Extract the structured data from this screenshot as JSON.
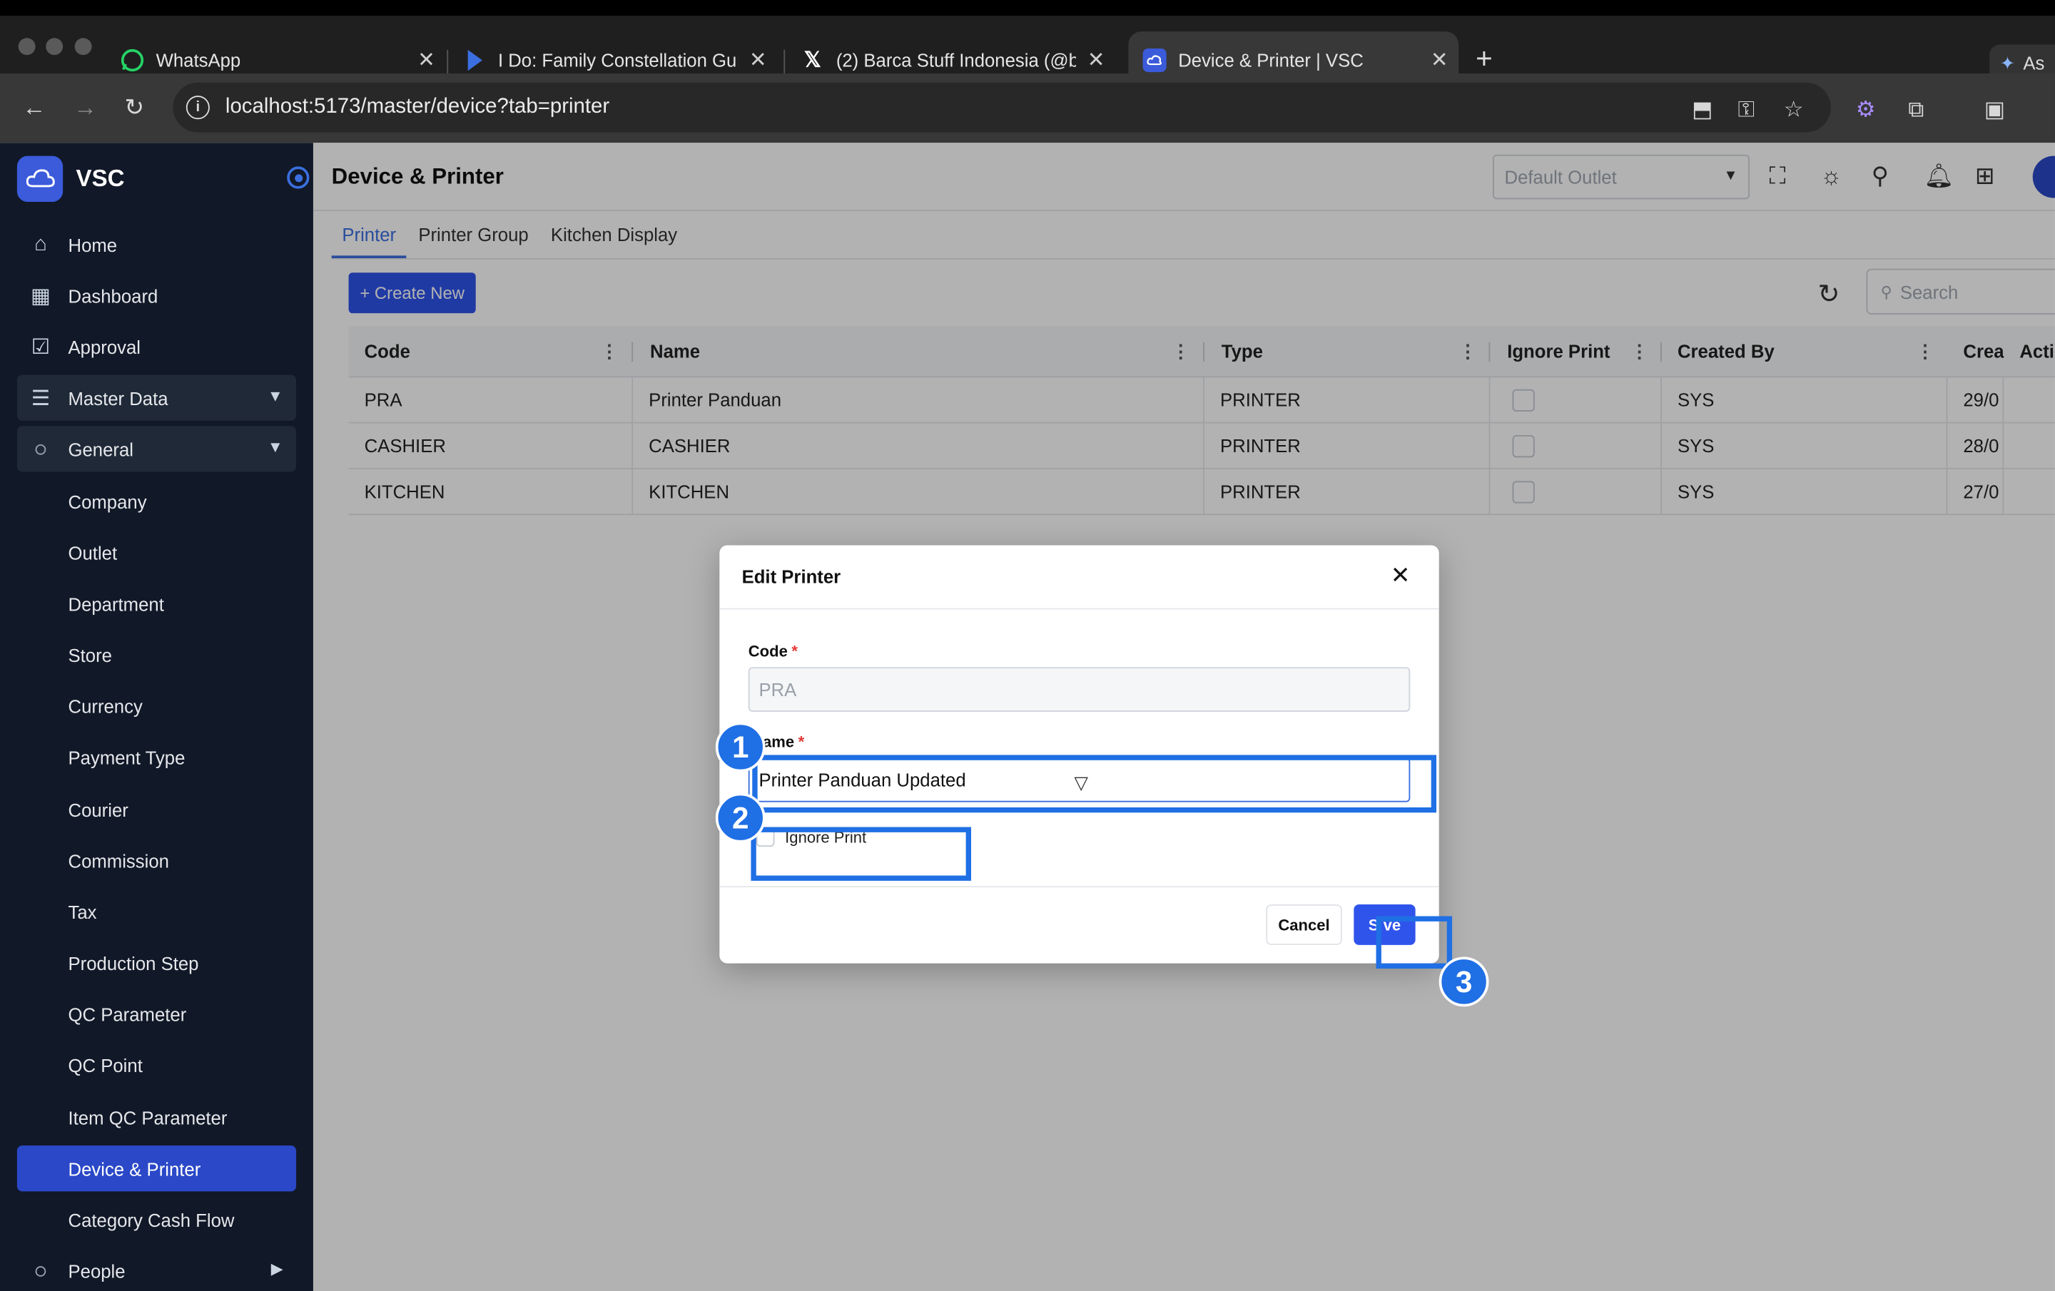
{
  "browser": {
    "tabs": [
      {
        "label": "WhatsApp",
        "icon": "whatsapp-icon"
      },
      {
        "label": "I Do: Family Constellation Gui",
        "icon": "bookmark-flag-icon"
      },
      {
        "label": "(2) Barca Stuff Indonesia (@b",
        "icon": "x-logo-icon"
      },
      {
        "label": "Device & Printer | VSC",
        "icon": "vsc-cloud-icon"
      }
    ],
    "profile_label": "As",
    "url": "localhost:5173/master/device?tab=printer"
  },
  "app": {
    "brand": "VSC",
    "sidebar": {
      "items": [
        {
          "label": "Home",
          "icon": "home-icon"
        },
        {
          "label": "Dashboard",
          "icon": "dashboard-icon"
        },
        {
          "label": "Approval",
          "icon": "approval-icon"
        },
        {
          "label": "Master Data",
          "icon": "database-icon"
        },
        {
          "label": "General"
        },
        {
          "label": "Company"
        },
        {
          "label": "Outlet"
        },
        {
          "label": "Department"
        },
        {
          "label": "Store"
        },
        {
          "label": "Currency"
        },
        {
          "label": "Payment Type"
        },
        {
          "label": "Courier"
        },
        {
          "label": "Commission"
        },
        {
          "label": "Tax"
        },
        {
          "label": "Production Step"
        },
        {
          "label": "QC Parameter"
        },
        {
          "label": "QC Point"
        },
        {
          "label": "Item QC Parameter"
        },
        {
          "label": "Device & Printer"
        },
        {
          "label": "Category Cash Flow"
        },
        {
          "label": "People"
        }
      ]
    },
    "header": {
      "title": "Device & Printer",
      "outlet_placeholder": "Default Outlet"
    },
    "tabs": [
      "Printer",
      "Printer Group",
      "Kitchen Display"
    ],
    "toolbar": {
      "create_label": "+ Create New",
      "search_placeholder": "Search"
    },
    "table": {
      "columns": [
        "Code",
        "Name",
        "Type",
        "Ignore Print",
        "Created By",
        "Crea",
        "Acti"
      ],
      "rows": [
        {
          "code": "PRA",
          "name": "Printer Panduan",
          "type": "PRINTER",
          "ignore_print": false,
          "created_by": "SYS",
          "created": "29/0"
        },
        {
          "code": "CASHIER",
          "name": "CASHIER",
          "type": "PRINTER",
          "ignore_print": false,
          "created_by": "SYS",
          "created": "28/0"
        },
        {
          "code": "KITCHEN",
          "name": "KITCHEN",
          "type": "PRINTER",
          "ignore_print": false,
          "created_by": "SYS",
          "created": "27/0"
        }
      ]
    },
    "modal": {
      "title": "Edit Printer",
      "code_label": "Code",
      "code_value": "PRA",
      "name_label": "ame",
      "name_value": "Printer Panduan Updated",
      "ignore_print_label": "Ignore Print",
      "cancel_label": "Cancel",
      "save_label": "S ve",
      "required_mark": "*"
    },
    "annotations": [
      "1",
      "2",
      "3"
    ]
  },
  "colors": {
    "primary": "#2f54eb",
    "sidebar_bg": "#111827",
    "sidebar_active": "#2a48c7",
    "annotation": "#1f6fe5"
  }
}
